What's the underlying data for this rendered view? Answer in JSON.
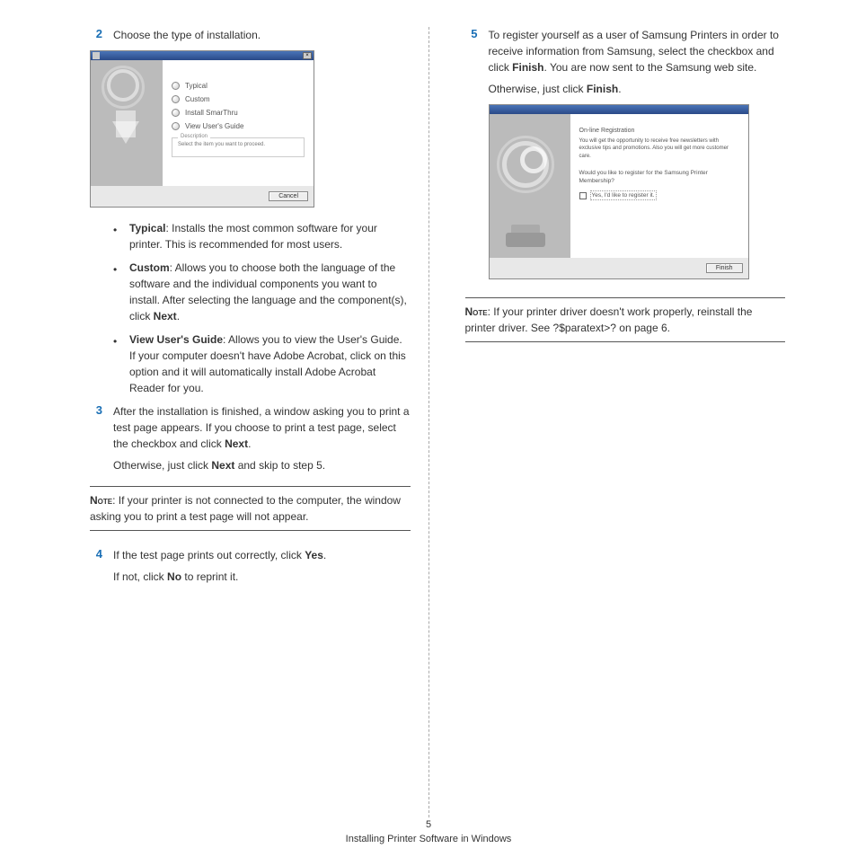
{
  "left": {
    "step2_num": "2",
    "step2_text": "Choose the type of installation.",
    "dialog1": {
      "opts": [
        "Typical",
        "Custom",
        "Install SmarThru",
        "View User's Guide"
      ],
      "desc_legend": "Description",
      "desc_text": "Select the item you want to proceed.",
      "cancel": "Cancel"
    },
    "bullets": {
      "typical_label": "Typical",
      "typical_text": ": Installs the most common software for your printer. This is recommended for most users.",
      "custom_label": "Custom",
      "custom_text_a": ": Allows you to choose both the language of the software and the individual components you want to install. After selecting the language and the component(s), click ",
      "custom_bold": "Next",
      "custom_text_b": ".",
      "view_label": "View User's Guide",
      "view_text": ": Allows you to view the User's Guide. If your computer doesn't have Adobe Acrobat, click on this option and it will automatically install Adobe Acrobat Reader for you."
    },
    "step3_num": "3",
    "step3_a": "After the installation is finished, a window asking you to print a test page appears. If you choose to print a test page, select the checkbox and click ",
    "step3_bold": "Next",
    "step3_b": ".",
    "step3_otherwise_a": "Otherwise, just click ",
    "step3_otherwise_bold": "Next",
    "step3_otherwise_b": " and skip to step 5.",
    "note_label": "Note",
    "note_text": ": If your printer is not connected to the computer, the window asking you to print a test page will not appear.",
    "step4_num": "4",
    "step4_a": "If the test page prints out correctly, click ",
    "step4_bold1": "Yes",
    "step4_b": ".",
    "step4_c": "If not, click ",
    "step4_bold2": "No",
    "step4_d": " to reprint it."
  },
  "right": {
    "step5_num": "5",
    "step5_a": "To register yourself as a user of Samsung Printers in order to receive information from Samsung, select the checkbox and click ",
    "step5_bold": "Finish",
    "step5_b": ". You are now sent to the Samsung web site.",
    "step5_otherwise_a": "Otherwise, just click ",
    "step5_otherwise_bold": "Finish",
    "step5_otherwise_b": ".",
    "dialog2": {
      "reg_title": "On-line Registration",
      "reg_text": "You will get the opportunity to receive free newsletters with exclusive tips and promotions. Also you will get more customer care.",
      "question": "Would you like to register for the Samsung Printer Membership?",
      "chk_label": "Yes, I'd like to register it.",
      "finish": "Finish"
    },
    "note_label": "Note",
    "note_text": ": If your printer driver doesn't work properly, reinstall the printer driver. See ?$paratext>? on page 6."
  },
  "footer": {
    "page_num": "5",
    "title": "Installing Printer Software in Windows"
  }
}
